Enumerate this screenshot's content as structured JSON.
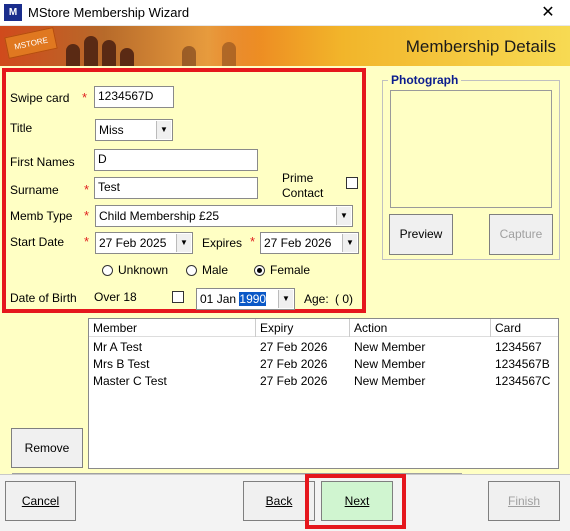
{
  "window": {
    "title": "MStore Membership Wizard",
    "icon_text": "M",
    "close_glyph": "✕"
  },
  "banner": {
    "card_text": "MSTORE",
    "heading": "Membership Details"
  },
  "form": {
    "swipe_card": {
      "label": "Swipe card",
      "value": "1234567D"
    },
    "title": {
      "label": "Title",
      "value": "Miss"
    },
    "first_names": {
      "label": "First Names",
      "value": "D"
    },
    "surname": {
      "label": "Surname",
      "value": "Test"
    },
    "prime_contact": {
      "label_line1": "Prime",
      "label_line2": "Contact",
      "checked": false
    },
    "memb_type": {
      "label": "Memb Type",
      "value": "Child Membership £25"
    },
    "start_date": {
      "label": "Start Date",
      "value": "27 Feb 2025"
    },
    "expires": {
      "label": "Expires",
      "value": "27 Feb 2026"
    },
    "gender": {
      "options": [
        "Unknown",
        "Male",
        "Female"
      ],
      "selected": "Female"
    },
    "dob": {
      "label": "Date of Birth",
      "over18_label": "Over 18",
      "day": "01",
      "month": "Jan",
      "year": "1990",
      "age_label": "Age:",
      "age_value": "( 0)"
    },
    "required_mark": "*",
    "dropdown_glyph": "▼"
  },
  "photo": {
    "group_title": "Photograph",
    "preview_label": "Preview",
    "capture_label": "Capture"
  },
  "members": {
    "columns": [
      "Member",
      "Expiry",
      "Action",
      "Card"
    ],
    "rows": [
      {
        "member": "Mr A Test",
        "expiry": "27 Feb 2026",
        "action": "New Member",
        "card": "1234567"
      },
      {
        "member": "Mrs B Test",
        "expiry": "27 Feb 2026",
        "action": "New Member",
        "card": "1234567B"
      },
      {
        "member": "Master C Test",
        "expiry": "27 Feb 2026",
        "action": "New Member",
        "card": "1234567C"
      }
    ],
    "remove_label": "Remove"
  },
  "footer": {
    "cancel": "Cancel",
    "back": "Back",
    "next": "Next",
    "finish": "Finish"
  },
  "colors": {
    "panel_bg": "#ffffc4",
    "highlight_red": "#e5171d",
    "group_title": "#0b1c8e",
    "selection": "#0a58c7"
  }
}
